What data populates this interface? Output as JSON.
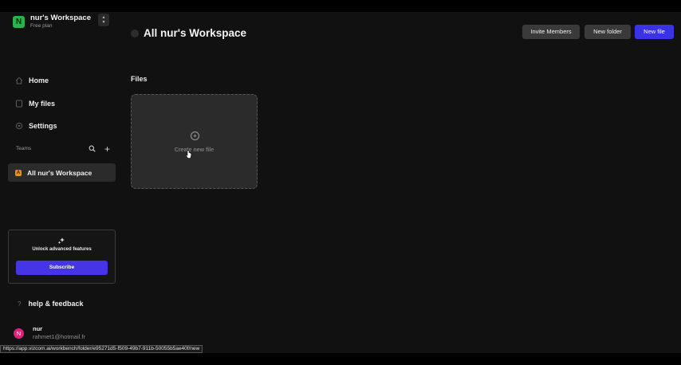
{
  "workspace": {
    "initial": "N",
    "name": "nur's Workspace",
    "plan": "Free plan"
  },
  "sidebar": {
    "items": [
      {
        "label": "Home",
        "icon": "home-icon"
      },
      {
        "label": "My files",
        "icon": "file-icon"
      },
      {
        "label": "Settings",
        "icon": "gear-icon"
      }
    ],
    "teams_label": "Teams",
    "team": {
      "initial": "A",
      "label": "All nur's Workspace"
    },
    "upsell": {
      "text": "Unlock advanced features",
      "button": "Subscribe"
    },
    "help": "help & feedback",
    "user": {
      "initial": "N",
      "name": "nur",
      "email": "rahmet1@hotmail.fr"
    }
  },
  "header": {
    "title": "All nur's Workspace",
    "buttons": {
      "invite": "Invite Members",
      "new_folder": "New folder",
      "new_file": "New file"
    }
  },
  "main": {
    "section_title": "Files",
    "create_label": "Create new file"
  },
  "status_url": "https://app.vizcom.ai/workbench/folder/e95271d5-f509-49b7-911b-50055b5ae40f/new",
  "colors": {
    "accent": "#4535e6",
    "workspace_avatar": "#29b34a",
    "team_avatar": "#e8901c",
    "user_avatar": "#e0217a"
  }
}
